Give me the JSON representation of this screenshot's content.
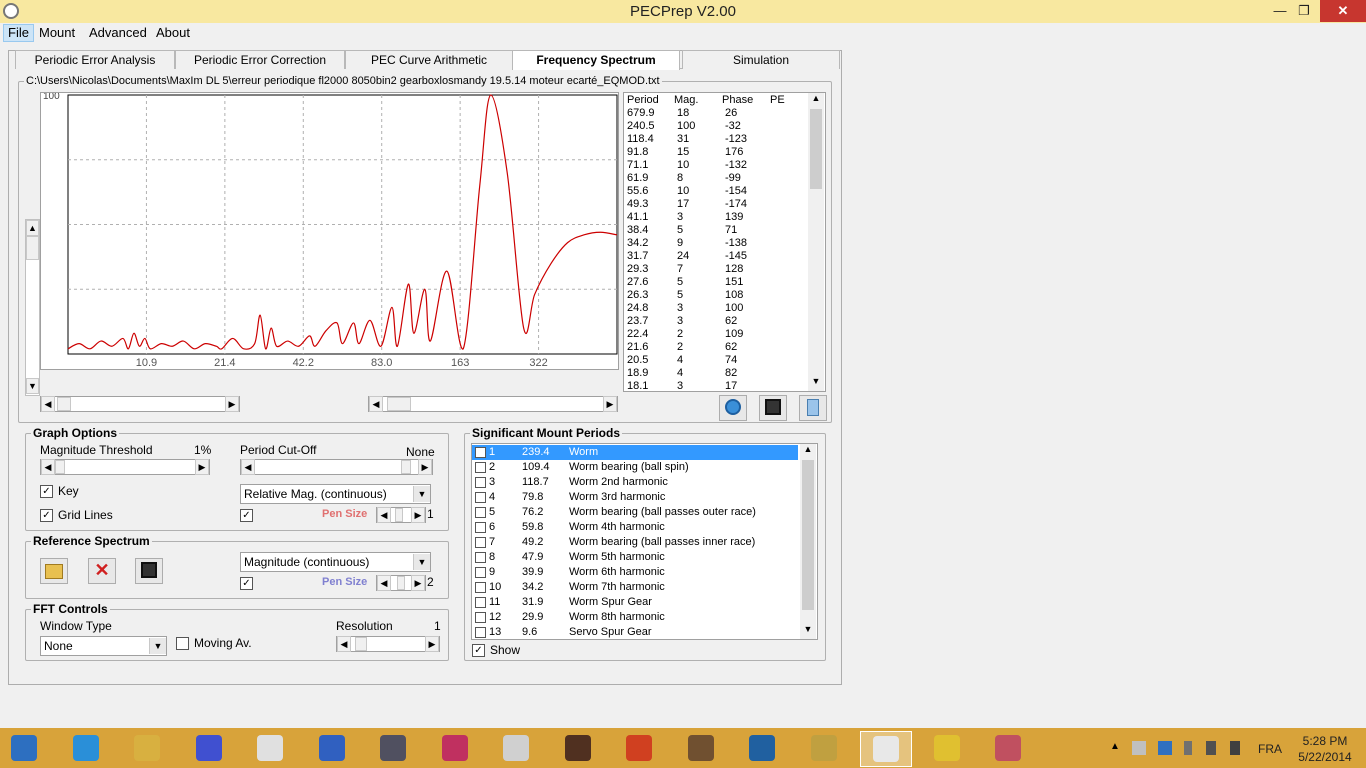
{
  "window": {
    "title": "PECPrep V2.00",
    "min_label": "—",
    "max_label": "❐",
    "close_label": "✕"
  },
  "menu": [
    "File",
    "Mount",
    "Advanced",
    "About"
  ],
  "tabs": [
    "Periodic Error Analysis",
    "Periodic Error Correction",
    "PEC Curve Arithmetic",
    "Frequency Spectrum",
    "Simulation"
  ],
  "file_path": "C:\\Users\\Nicolas\\Documents\\MaxIm DL 5\\erreur periodique fl2000 8050bin2 gearboxlosmandy 19.5.14 moteur ecarté_EQMOD.txt",
  "chart_data": {
    "type": "line",
    "x_tick_labels": [
      "10.9",
      "21.4",
      "42.2",
      "83.0",
      "163",
      "322"
    ],
    "y_top_label": "100",
    "grid": true,
    "series_color": "#cc0000",
    "series": [
      {
        "values": [
          [
            0.0,
            2
          ],
          [
            0.02,
            4
          ],
          [
            0.04,
            2
          ],
          [
            0.06,
            5
          ],
          [
            0.08,
            3
          ],
          [
            0.1,
            6
          ],
          [
            0.11,
            2
          ],
          [
            0.12,
            8
          ],
          [
            0.13,
            3
          ],
          [
            0.14,
            6
          ],
          [
            0.15,
            2
          ],
          [
            0.17,
            4
          ],
          [
            0.19,
            3
          ],
          [
            0.21,
            5
          ],
          [
            0.23,
            2
          ],
          [
            0.25,
            4
          ],
          [
            0.27,
            3
          ],
          [
            0.28,
            2
          ],
          [
            0.3,
            6
          ],
          [
            0.32,
            2
          ],
          [
            0.34,
            4
          ],
          [
            0.35,
            15
          ],
          [
            0.36,
            2
          ],
          [
            0.37,
            10
          ],
          [
            0.38,
            3
          ],
          [
            0.4,
            5
          ],
          [
            0.42,
            3
          ],
          [
            0.44,
            7
          ],
          [
            0.45,
            3
          ],
          [
            0.47,
            9
          ],
          [
            0.49,
            12
          ],
          [
            0.5,
            4
          ],
          [
            0.52,
            12
          ],
          [
            0.53,
            4
          ],
          [
            0.55,
            13
          ],
          [
            0.57,
            3
          ],
          [
            0.59,
            18
          ],
          [
            0.6,
            3
          ],
          [
            0.62,
            27
          ],
          [
            0.63,
            8
          ],
          [
            0.65,
            25
          ],
          [
            0.66,
            5
          ],
          [
            0.69,
            32
          ],
          [
            0.72,
            2
          ],
          [
            0.75,
            65
          ],
          [
            0.77,
            100
          ],
          [
            0.8,
            70
          ],
          [
            0.83,
            10
          ],
          [
            0.85,
            23
          ],
          [
            0.88,
            35
          ],
          [
            0.91,
            43
          ],
          [
            0.94,
            46
          ],
          [
            0.97,
            47
          ],
          [
            1.0,
            46
          ]
        ]
      }
    ]
  },
  "pe_list": {
    "headers": [
      "Period",
      "Mag.",
      "Phase",
      "PE"
    ],
    "rows": [
      [
        "679.9",
        "18",
        "26"
      ],
      [
        "240.5",
        "100",
        "-32"
      ],
      [
        "118.4",
        "31",
        "-123"
      ],
      [
        "91.8",
        "15",
        "176"
      ],
      [
        "71.1",
        "10",
        "-132"
      ],
      [
        "61.9",
        "8",
        "-99"
      ],
      [
        "55.6",
        "10",
        "-154"
      ],
      [
        "49.3",
        "17",
        "-174"
      ],
      [
        "41.1",
        "3",
        "139"
      ],
      [
        "38.4",
        "5",
        "71"
      ],
      [
        "34.2",
        "9",
        "-138"
      ],
      [
        "31.7",
        "24",
        "-145"
      ],
      [
        "29.3",
        "7",
        "128"
      ],
      [
        "27.6",
        "5",
        "151"
      ],
      [
        "26.3",
        "5",
        "108"
      ],
      [
        "24.8",
        "3",
        "100"
      ],
      [
        "23.7",
        "3",
        "62"
      ],
      [
        "22.4",
        "2",
        "109"
      ],
      [
        "21.6",
        "2",
        "62"
      ],
      [
        "20.5",
        "4",
        "74"
      ],
      [
        "18.9",
        "4",
        "82"
      ],
      [
        "18.1",
        "3",
        "17"
      ]
    ]
  },
  "graph_options": {
    "title": "Graph Options",
    "mag_threshold_label": "Magnitude Threshold",
    "mag_threshold_value": "1%",
    "period_cutoff_label": "Period Cut-Off",
    "period_cutoff_value": "None",
    "key_label": "Key",
    "grid_lines_label": "Grid Lines",
    "mode_value": "Relative Mag. (continuous)",
    "pen_size_label": "Pen Size",
    "pen_size_value": "1",
    "pen_color": "#e07070"
  },
  "reference": {
    "title": "Reference Spectrum",
    "mode_value": "Magnitude (continuous)",
    "pen_size_label": "Pen Size",
    "pen_size_value": "2",
    "pen_color": "#8080d0"
  },
  "fft": {
    "title": "FFT Controls",
    "window_type_label": "Window Type",
    "window_type_value": "None",
    "moving_av_label": "Moving Av.",
    "resolution_label": "Resolution",
    "resolution_value": "1"
  },
  "mount_periods": {
    "title": "Significant Mount Periods",
    "show_label": "Show",
    "rows": [
      [
        "1",
        "239.4",
        "Worm"
      ],
      [
        "2",
        "109.4",
        "Worm bearing (ball spin)"
      ],
      [
        "3",
        "118.7",
        "Worm 2nd harmonic"
      ],
      [
        "4",
        "79.8",
        "Worm 3rd harmonic"
      ],
      [
        "5",
        "76.2",
        "Worm bearing (ball passes outer race)"
      ],
      [
        "6",
        "59.8",
        "Worm 4th harmonic"
      ],
      [
        "7",
        "49.2",
        "Worm bearing (ball passes inner race)"
      ],
      [
        "8",
        "47.9",
        "Worm 5th harmonic"
      ],
      [
        "9",
        "39.9",
        "Worm 6th harmonic"
      ],
      [
        "10",
        "34.2",
        "Worm 7th harmonic"
      ],
      [
        "11",
        "31.9",
        "Worm Spur Gear"
      ],
      [
        "12",
        "29.9",
        "Worm 8th harmonic"
      ],
      [
        "13",
        "9.6",
        "Servo Spur Gear"
      ]
    ]
  },
  "taskbar": {
    "icons": [
      "windows-start-icon",
      "internet-explorer-icon",
      "file-explorer-icon",
      "cube-app-icon",
      "telescope-icon",
      "globe-icon",
      "comet-icon",
      "color-app-icon",
      "film-reel-icon",
      "camera-icon",
      "pickaxe-icon",
      "owl-icon",
      "stellarium-icon",
      "compass-icon",
      "pecprep-icon",
      "gear-app-icon",
      "eqmod-icon"
    ],
    "lang": "FRA",
    "time": "5:28 PM",
    "date": "5/22/2014"
  }
}
